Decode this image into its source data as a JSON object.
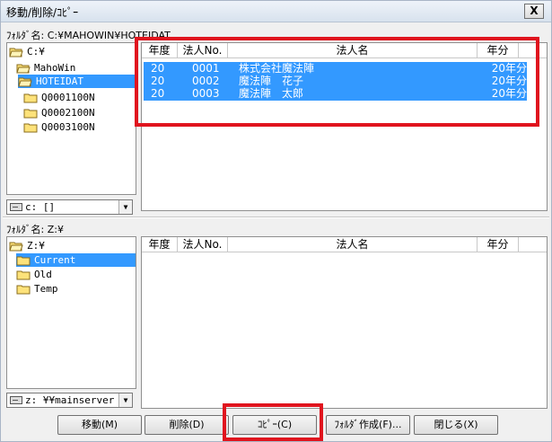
{
  "window": {
    "title": "移動/削除/ｺﾋﾟｰ",
    "close_label": "X"
  },
  "upper": {
    "folder_caption": "ﾌｫﾙﾀﾞ名: C:¥MAHOWIN¥HOTEIDAT",
    "tree": [
      {
        "label": "C:¥",
        "state": "open"
      },
      {
        "label": "MahoWin",
        "state": "open"
      },
      {
        "label": "HOTEIDAT",
        "state": "open",
        "selected": true
      },
      {
        "label": "Q0001100N",
        "state": "closed"
      },
      {
        "label": "Q0002100N",
        "state": "closed"
      },
      {
        "label": "Q0003100N",
        "state": "closed"
      }
    ],
    "drive": "c: []",
    "columns": [
      "年度",
      "法人No.",
      "法人名",
      "年分"
    ],
    "rows": [
      {
        "year": "20",
        "no": "0001",
        "name": "株式会社魔法陣",
        "period": "20年分"
      },
      {
        "year": "20",
        "no": "0002",
        "name": "魔法陣　花子",
        "period": "20年分"
      },
      {
        "year": "20",
        "no": "0003",
        "name": "魔法陣　太郎",
        "period": "20年分"
      }
    ]
  },
  "lower": {
    "folder_caption": "ﾌｫﾙﾀﾞ名: Z:¥",
    "tree": [
      {
        "label": "Z:¥",
        "state": "open"
      },
      {
        "label": "Current",
        "state": "closed",
        "selected": true
      },
      {
        "label": "Old",
        "state": "closed"
      },
      {
        "label": "Temp",
        "state": "closed"
      }
    ],
    "drive": "z: ¥¥mainserver",
    "columns": [
      "年度",
      "法人No.",
      "法人名",
      "年分"
    ]
  },
  "buttons": {
    "move": "移動(M)",
    "delete": "削除(D)",
    "copy": "ｺﾋﾟｰ(C)",
    "new_folder": "ﾌｫﾙﾀﾞ作成(F)...",
    "close": "閉じる(X)"
  },
  "colors": {
    "selection": "#3399ff",
    "highlight_box": "#e0141e"
  }
}
